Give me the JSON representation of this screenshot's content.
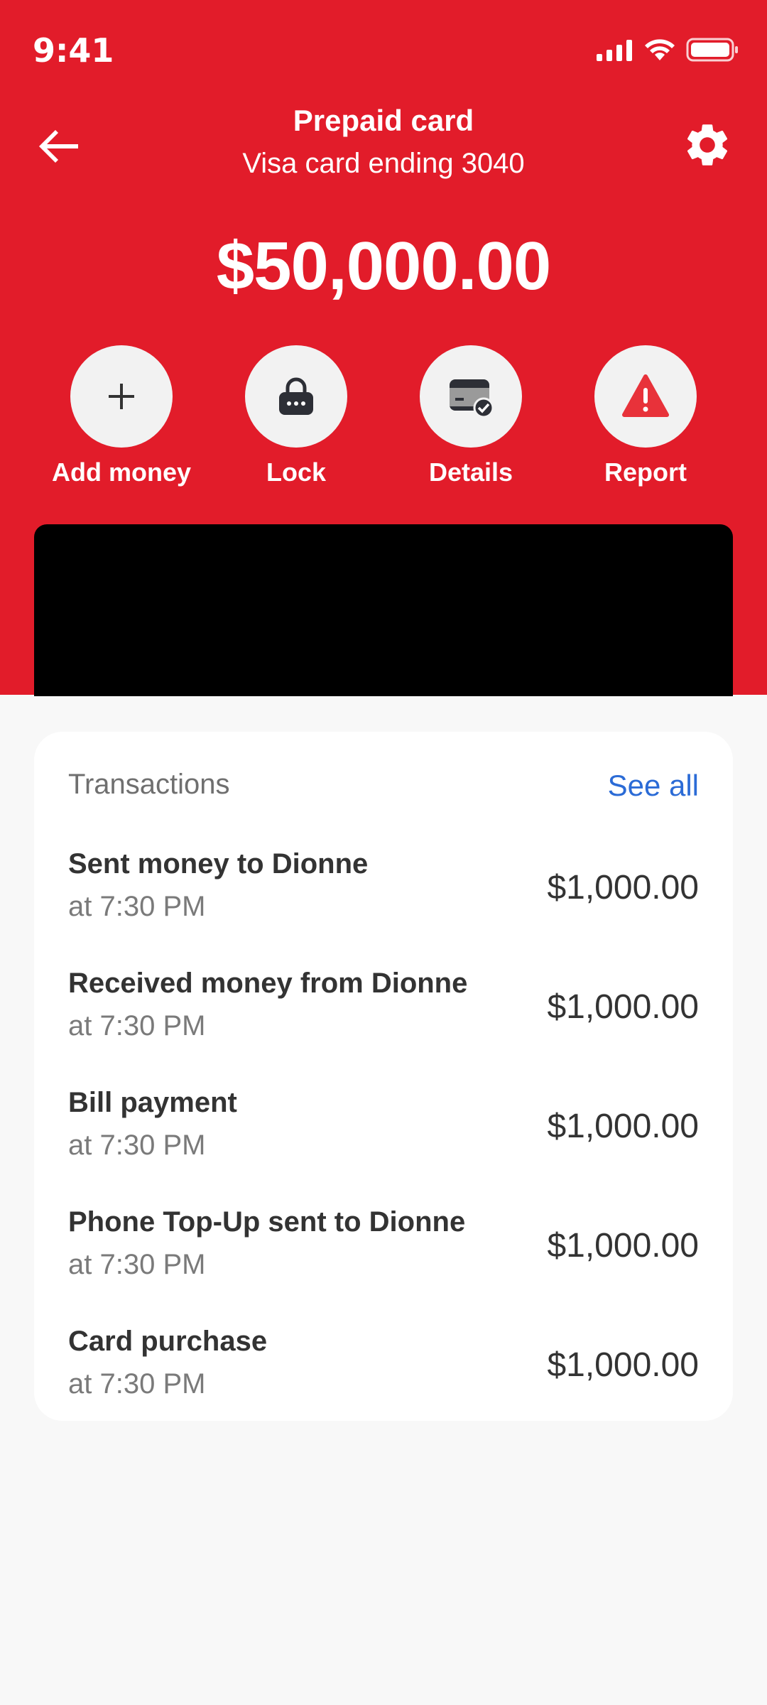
{
  "status": {
    "time": "9:41"
  },
  "header": {
    "title": "Prepaid card",
    "subtitle": "Visa card ending 3040",
    "balance": "$50,000.00"
  },
  "actions": [
    {
      "label": "Add money",
      "icon": "plus-icon"
    },
    {
      "label": "Lock",
      "icon": "lock-icon"
    },
    {
      "label": "Details",
      "icon": "card-details-icon"
    },
    {
      "label": "Report",
      "icon": "warning-icon"
    }
  ],
  "transactions": {
    "heading": "Transactions",
    "see_all": "See all",
    "items": [
      {
        "title": "Sent money to Dionne",
        "time": "at 7:30 PM",
        "amount": "$1,000.00"
      },
      {
        "title": "Received money from Dionne",
        "time": "at 7:30 PM",
        "amount": "$1,000.00"
      },
      {
        "title": "Bill payment",
        "time": "at 7:30 PM",
        "amount": "$1,000.00"
      },
      {
        "title": "Phone Top-Up sent to Dionne",
        "time": "at 7:30 PM",
        "amount": "$1,000.00"
      },
      {
        "title": "Card purchase",
        "time": "at 7:30 PM",
        "amount": "$1,000.00"
      }
    ]
  },
  "colors": {
    "brand": "#e21c2a",
    "link": "#2b6bd6",
    "background": "#f8f8f8"
  }
}
